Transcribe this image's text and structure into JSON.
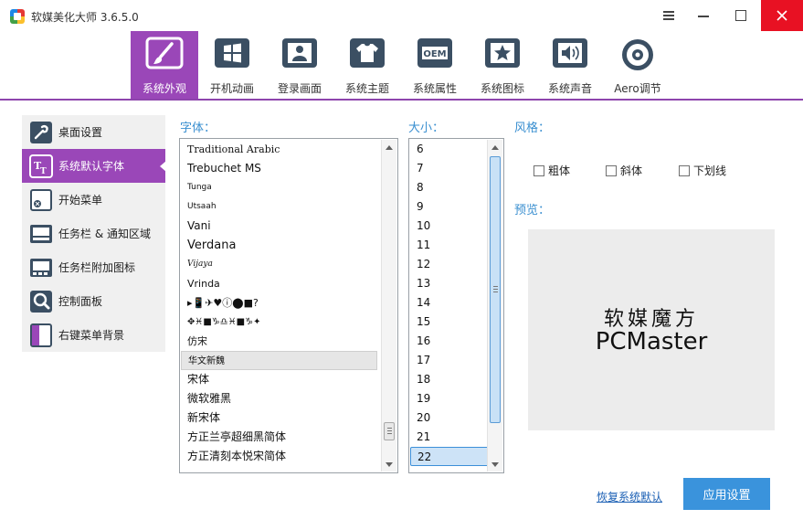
{
  "window": {
    "title": "软媒美化大师 3.6.5.0"
  },
  "tabs": [
    {
      "label": "系统外观",
      "icon": "brush-icon",
      "active": true
    },
    {
      "label": "开机动画",
      "icon": "windows-logo-icon",
      "active": false
    },
    {
      "label": "登录画面",
      "icon": "user-icon",
      "active": false
    },
    {
      "label": "系统主题",
      "icon": "shirt-icon",
      "active": false
    },
    {
      "label": "系统属性",
      "icon": "oem-icon",
      "active": false
    },
    {
      "label": "系统图标",
      "icon": "star-icon",
      "active": false
    },
    {
      "label": "系统声音",
      "icon": "speaker-icon",
      "active": false
    },
    {
      "label": "Aero调节",
      "icon": "aero-icon",
      "active": false
    }
  ],
  "sidebar": {
    "items": [
      {
        "label": "桌面设置",
        "icon": "wrench-icon",
        "active": false
      },
      {
        "label": "系统默认字体",
        "icon": "font-icon",
        "active": true
      },
      {
        "label": "开始菜单",
        "icon": "start-menu-icon",
        "active": false
      },
      {
        "label": "任务栏 & 通知区域",
        "icon": "taskbar-icon",
        "active": false
      },
      {
        "label": "任务栏附加图标",
        "icon": "taskbar-icons-icon",
        "active": false
      },
      {
        "label": "控制面板",
        "icon": "control-panel-icon",
        "active": false
      },
      {
        "label": "右键菜单背景",
        "icon": "context-menu-icon",
        "active": false
      }
    ]
  },
  "font_panel": {
    "label": "字体：",
    "items": [
      "Traditional Arabic",
      "Trebuchet MS",
      "Tunga",
      "Utsaah",
      "Vani",
      "Verdana",
      "Vijaya",
      "Vrinda",
      "▸📱✈♥ⓘ⬤■?",
      "✥♓■♑♎♓■♑✦",
      "仿宋",
      "华文新魏",
      "宋体",
      "微软雅黑",
      "新宋体",
      "方正兰亭超细黑简体",
      "方正清刻本悦宋简体"
    ],
    "selected_index": 11
  },
  "size_panel": {
    "label": "大小：",
    "items": [
      "6",
      "7",
      "8",
      "9",
      "10",
      "11",
      "12",
      "13",
      "14",
      "15",
      "16",
      "17",
      "18",
      "19",
      "20",
      "21",
      "22"
    ],
    "selected_index": 16
  },
  "style_panel": {
    "label": "风格：",
    "options": [
      {
        "label": "粗体",
        "checked": false
      },
      {
        "label": "斜体",
        "checked": false
      },
      {
        "label": "下划线",
        "checked": false
      }
    ]
  },
  "preview_panel": {
    "label": "预览：",
    "line1": "软媒魔方",
    "line2": "PCMaster"
  },
  "actions": {
    "restore_label": "恢复系统默认",
    "apply_label": "应用设置"
  },
  "colors": {
    "accent_purple": "#9a47b8",
    "label_blue": "#3a8fd0",
    "apply_blue": "#3a93dc",
    "close_red": "#e81123"
  }
}
